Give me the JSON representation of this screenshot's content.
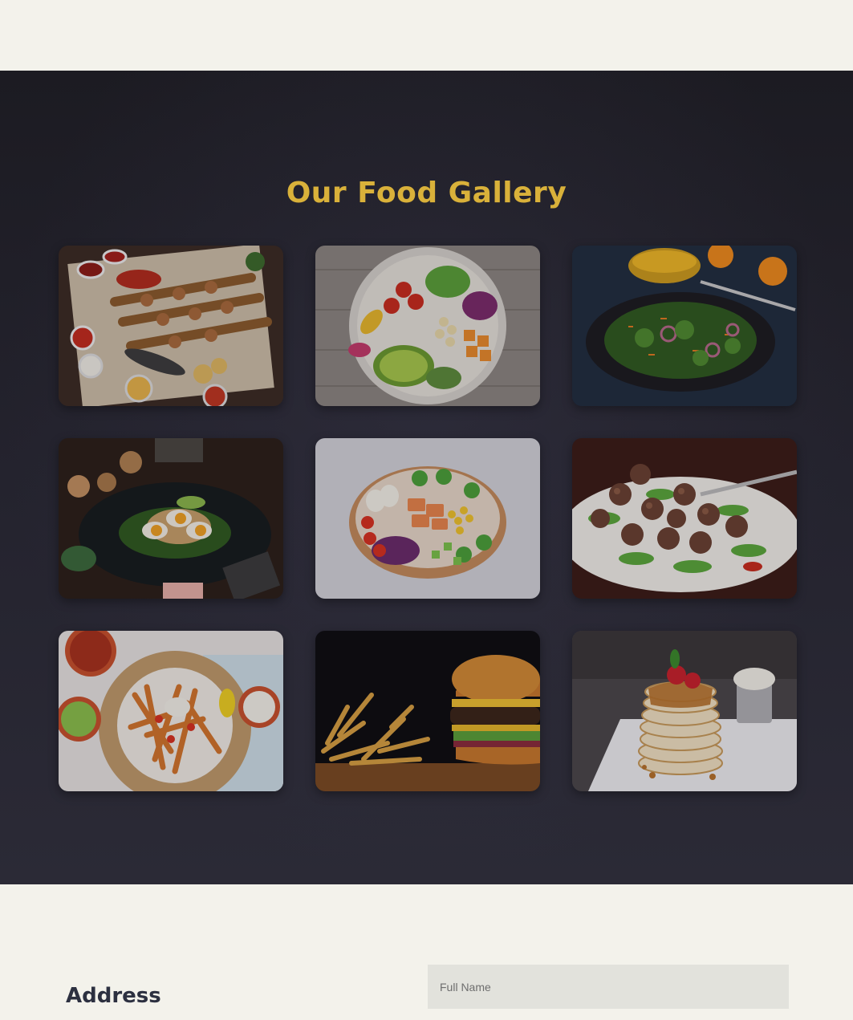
{
  "gallery": {
    "title": "Our Food Gallery",
    "title_color": "#d9b13a",
    "images": [
      {
        "name": "grilled-kebab-platter-image"
      },
      {
        "name": "veggie-avocado-bowl-image"
      },
      {
        "name": "dark-plate-salad-image"
      },
      {
        "name": "egg-avocado-toast-image"
      },
      {
        "name": "salmon-poke-bowl-image"
      },
      {
        "name": "meatball-arugula-plate-image"
      },
      {
        "name": "loaded-fries-image"
      },
      {
        "name": "burger-and-fries-image"
      },
      {
        "name": "pancake-stack-image"
      }
    ]
  },
  "contact": {
    "address_heading": "Address",
    "full_name_placeholder": "Full Name"
  }
}
